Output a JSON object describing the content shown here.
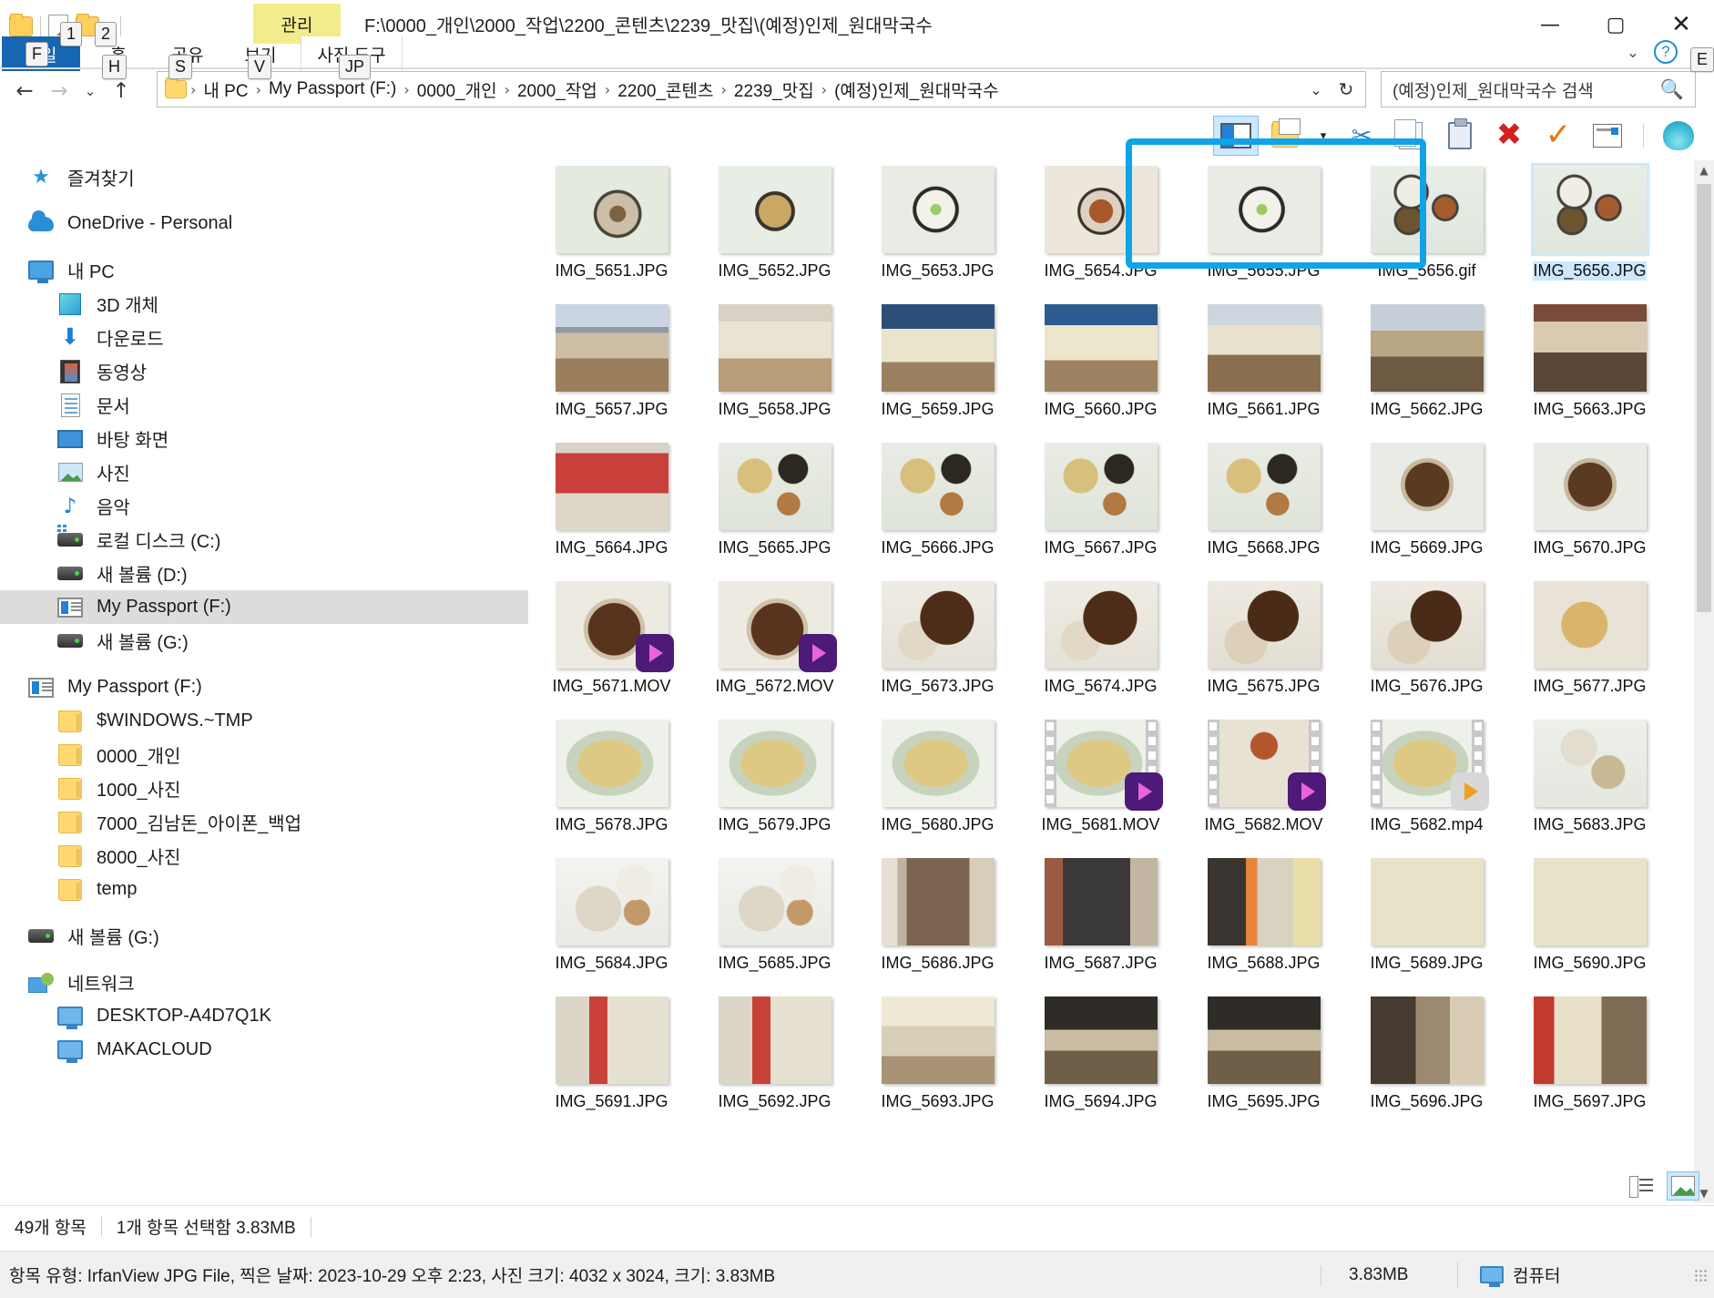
{
  "window": {
    "title": "F:\\0000_개인\\2000_작업\\2200_콘텐츠\\2239_맛집\\(예정)인제_원대막국수",
    "minimize": "—",
    "maximize": "▢",
    "close": "✕"
  },
  "quick_access": {
    "folder_icon": "folder-icon",
    "properties_icon": "properties-icon",
    "new_folder_icon": "new-folder-icon",
    "customize_arrow": "▾"
  },
  "ribbon": {
    "contextual_tab_group": "관리",
    "tabs": [
      {
        "id": "file",
        "label": "파일",
        "keytip": "F"
      },
      {
        "id": "home",
        "label": "홈",
        "keytip": "H"
      },
      {
        "id": "share",
        "label": "공유",
        "keytip": "S"
      },
      {
        "id": "view",
        "label": "보기",
        "keytip": "V"
      },
      {
        "id": "phototools",
        "label": "사진 도구",
        "keytip": "JP"
      }
    ],
    "qat_keytips": [
      "1",
      "2"
    ],
    "collapse_glyph": "⌄",
    "help_glyph": "?",
    "help_keytip": "E"
  },
  "address_bar": {
    "back_glyph": "←",
    "forward_glyph": "→",
    "recent_glyph": "⌄",
    "up_glyph": "↑",
    "breadcrumbs": [
      "내 PC",
      "My Passport (F:)",
      "0000_개인",
      "2000_작업",
      "2200_콘텐츠",
      "2239_맛집",
      "(예정)인제_원대막국수"
    ],
    "separator": "›",
    "dropdown_glyph": "⌄",
    "refresh_glyph": "↻"
  },
  "search": {
    "placeholder": "(예정)인제_원대막국수 검색",
    "icon": "search-icon"
  },
  "command_bar": {
    "items": [
      {
        "name": "navigation-pane-toggle",
        "label": "탐색 창",
        "active": true
      },
      {
        "name": "new-folder",
        "label": "새 폴더",
        "active": false
      },
      {
        "name": "new-folder-dropdown",
        "label": "▾",
        "active": false
      },
      {
        "name": "cut",
        "label": "잘라내기",
        "active": false
      },
      {
        "name": "copy",
        "label": "복사",
        "active": false
      },
      {
        "name": "paste",
        "label": "붙여넣기",
        "active": false
      },
      {
        "name": "delete",
        "label": "삭제",
        "active": false
      },
      {
        "name": "confirm",
        "label": "확인",
        "active": false
      },
      {
        "name": "rename",
        "label": "이름 바꾸기",
        "active": false
      },
      {
        "name": "shell-extension",
        "label": "셸 확장",
        "active": false
      }
    ]
  },
  "nav_pane": {
    "items": [
      {
        "label": "즐겨찾기",
        "icon": "star-icon",
        "indent": 0,
        "selected": false
      },
      {
        "label": "",
        "icon": "",
        "indent": 0,
        "selected": false,
        "gap": true
      },
      {
        "label": "OneDrive - Personal",
        "icon": "cloud-icon",
        "indent": 0,
        "selected": false
      },
      {
        "label": "",
        "icon": "",
        "indent": 0,
        "selected": false,
        "gap": true
      },
      {
        "label": "내 PC",
        "icon": "monitor-icon",
        "indent": 0,
        "selected": false
      },
      {
        "label": "3D 개체",
        "icon": "cube-icon",
        "indent": 1,
        "selected": false
      },
      {
        "label": "다운로드",
        "icon": "download-icon",
        "indent": 1,
        "selected": false
      },
      {
        "label": "동영상",
        "icon": "film-icon",
        "indent": 1,
        "selected": false
      },
      {
        "label": "문서",
        "icon": "document-icon",
        "indent": 1,
        "selected": false
      },
      {
        "label": "바탕 화면",
        "icon": "desktop-icon",
        "indent": 1,
        "selected": false
      },
      {
        "label": "사진",
        "icon": "picture-icon",
        "indent": 1,
        "selected": false
      },
      {
        "label": "음악",
        "icon": "music-note-icon",
        "indent": 1,
        "selected": false
      },
      {
        "label": "로컬 디스크 (C:)",
        "icon": "system-drive-icon",
        "indent": 1,
        "selected": false
      },
      {
        "label": "새 볼륨 (D:)",
        "icon": "drive-icon",
        "indent": 1,
        "selected": false
      },
      {
        "label": "My Passport (F:)",
        "icon": "passport-drive-icon",
        "indent": 1,
        "selected": true
      },
      {
        "label": "새 볼륨 (G:)",
        "icon": "drive-icon",
        "indent": 1,
        "selected": false
      },
      {
        "label": "",
        "icon": "",
        "indent": 0,
        "selected": false,
        "gap": true
      },
      {
        "label": "My Passport (F:)",
        "icon": "passport-drive-icon",
        "indent": 0,
        "selected": false
      },
      {
        "label": "$WINDOWS.~TMP",
        "icon": "folder-icon",
        "indent": 1,
        "selected": false
      },
      {
        "label": "0000_개인",
        "icon": "folder-icon",
        "indent": 1,
        "selected": false
      },
      {
        "label": "1000_사진",
        "icon": "folder-icon",
        "indent": 1,
        "selected": false
      },
      {
        "label": "7000_김남돈_아이폰_백업",
        "icon": "folder-icon",
        "indent": 1,
        "selected": false
      },
      {
        "label": "8000_사진",
        "icon": "folder-icon",
        "indent": 1,
        "selected": false
      },
      {
        "label": "temp",
        "icon": "folder-icon",
        "indent": 1,
        "selected": false
      },
      {
        "label": "",
        "icon": "",
        "indent": 0,
        "selected": false,
        "gap": true
      },
      {
        "label": "새 볼륨 (G:)",
        "icon": "drive-icon",
        "indent": 0,
        "selected": false
      },
      {
        "label": "",
        "icon": "",
        "indent": 0,
        "selected": false,
        "gap": true
      },
      {
        "label": "네트워크",
        "icon": "network-icon",
        "indent": 0,
        "selected": false
      },
      {
        "label": "DESKTOP-A4D7Q1K",
        "icon": "computer-icon",
        "indent": 1,
        "selected": false
      },
      {
        "label": "MAKACLOUD",
        "icon": "computer-icon",
        "indent": 1,
        "selected": false
      }
    ]
  },
  "files": [
    {
      "name": "IMG_5651.JPG",
      "kind": "image",
      "selected": false,
      "tint": "a"
    },
    {
      "name": "IMG_5652.JPG",
      "kind": "image",
      "selected": false,
      "tint": "b"
    },
    {
      "name": "IMG_5653.JPG",
      "kind": "image",
      "selected": false,
      "tint": "c"
    },
    {
      "name": "IMG_5654.JPG",
      "kind": "image",
      "selected": false,
      "tint": "d"
    },
    {
      "name": "IMG_5655.JPG",
      "kind": "image",
      "selected": false,
      "tint": "c"
    },
    {
      "name": "IMG_5656.gif",
      "kind": "image",
      "selected": false,
      "tint": "e"
    },
    {
      "name": "IMG_5656.JPG",
      "kind": "image",
      "selected": true,
      "tint": "e"
    },
    {
      "name": "IMG_5657.JPG",
      "kind": "image",
      "selected": false,
      "tint": "r1"
    },
    {
      "name": "IMG_5658.JPG",
      "kind": "image",
      "selected": false,
      "tint": "r2"
    },
    {
      "name": "IMG_5659.JPG",
      "kind": "image",
      "selected": false,
      "tint": "r3"
    },
    {
      "name": "IMG_5660.JPG",
      "kind": "image",
      "selected": false,
      "tint": "r4"
    },
    {
      "name": "IMG_5661.JPG",
      "kind": "image",
      "selected": false,
      "tint": "r5"
    },
    {
      "name": "IMG_5662.JPG",
      "kind": "image",
      "selected": false,
      "tint": "r6"
    },
    {
      "name": "IMG_5663.JPG",
      "kind": "image",
      "selected": false,
      "tint": "r7"
    },
    {
      "name": "IMG_5664.JPG",
      "kind": "image",
      "selected": false,
      "tint": "m1"
    },
    {
      "name": "IMG_5665.JPG",
      "kind": "image",
      "selected": false,
      "tint": "m2"
    },
    {
      "name": "IMG_5666.JPG",
      "kind": "image",
      "selected": false,
      "tint": "m2"
    },
    {
      "name": "IMG_5667.JPG",
      "kind": "image",
      "selected": false,
      "tint": "m2"
    },
    {
      "name": "IMG_5668.JPG",
      "kind": "image",
      "selected": false,
      "tint": "m2"
    },
    {
      "name": "IMG_5669.JPG",
      "kind": "image",
      "selected": false,
      "tint": "m3"
    },
    {
      "name": "IMG_5670.JPG",
      "kind": "image",
      "selected": false,
      "tint": "m3"
    },
    {
      "name": "IMG_5671.MOV",
      "kind": "video",
      "selected": false,
      "tint": "n1"
    },
    {
      "name": "IMG_5672.MOV",
      "kind": "video",
      "selected": false,
      "tint": "n1"
    },
    {
      "name": "IMG_5673.JPG",
      "kind": "image",
      "selected": false,
      "tint": "n2"
    },
    {
      "name": "IMG_5674.JPG",
      "kind": "image",
      "selected": false,
      "tint": "n2"
    },
    {
      "name": "IMG_5675.JPG",
      "kind": "image",
      "selected": false,
      "tint": "n3"
    },
    {
      "name": "IMG_5676.JPG",
      "kind": "image",
      "selected": false,
      "tint": "n3"
    },
    {
      "name": "IMG_5677.JPG",
      "kind": "image",
      "selected": false,
      "tint": "n4"
    },
    {
      "name": "IMG_5678.JPG",
      "kind": "image",
      "selected": false,
      "tint": "p1"
    },
    {
      "name": "IMG_5679.JPG",
      "kind": "image",
      "selected": false,
      "tint": "p1"
    },
    {
      "name": "IMG_5680.JPG",
      "kind": "image",
      "selected": false,
      "tint": "p1"
    },
    {
      "name": "IMG_5681.MOV",
      "kind": "video-film",
      "selected": false,
      "tint": "p1"
    },
    {
      "name": "IMG_5682.MOV",
      "kind": "video-film",
      "selected": false,
      "tint": "p2"
    },
    {
      "name": "IMG_5682.mp4",
      "kind": "video-film-orange",
      "selected": false,
      "tint": "p1"
    },
    {
      "name": "IMG_5683.JPG",
      "kind": "image",
      "selected": false,
      "tint": "p3"
    },
    {
      "name": "IMG_5684.JPG",
      "kind": "image",
      "selected": false,
      "tint": "q1"
    },
    {
      "name": "IMG_5685.JPG",
      "kind": "image",
      "selected": false,
      "tint": "q1"
    },
    {
      "name": "IMG_5686.JPG",
      "kind": "image",
      "selected": false,
      "tint": "q2"
    },
    {
      "name": "IMG_5687.JPG",
      "kind": "image",
      "selected": false,
      "tint": "q3"
    },
    {
      "name": "IMG_5688.JPG",
      "kind": "image",
      "selected": false,
      "tint": "q4"
    },
    {
      "name": "IMG_5689.JPG",
      "kind": "image",
      "selected": false,
      "tint": "q5"
    },
    {
      "name": "IMG_5690.JPG",
      "kind": "image",
      "selected": false,
      "tint": "q5"
    },
    {
      "name": "IMG_5691.JPG",
      "kind": "image",
      "selected": false,
      "tint": "s1"
    },
    {
      "name": "IMG_5692.JPG",
      "kind": "image",
      "selected": false,
      "tint": "s1"
    },
    {
      "name": "IMG_5693.JPG",
      "kind": "image",
      "selected": false,
      "tint": "s2"
    },
    {
      "name": "IMG_5694.JPG",
      "kind": "image",
      "selected": false,
      "tint": "s3"
    },
    {
      "name": "IMG_5695.JPG",
      "kind": "image",
      "selected": false,
      "tint": "s3"
    },
    {
      "name": "IMG_5696.JPG",
      "kind": "image",
      "selected": false,
      "tint": "s4"
    },
    {
      "name": "IMG_5697.JPG",
      "kind": "image",
      "selected": false,
      "tint": "s5"
    }
  ],
  "annotation": {
    "highlight_color": "#10a3e8",
    "target_label": "IMG_5656 pair highlight"
  },
  "status_bar": {
    "item_count": "49개 항목",
    "selection": "1개 항목 선택함 3.83MB",
    "details": "항목 유형: IrfanView JPG File, 찍은 날짜: 2023-10-29 오후 2:23, 사진 크기: 4032 x 3024, 크기: 3.83MB",
    "size": "3.83MB",
    "location": "컴퓨터",
    "location_icon": "computer-icon"
  },
  "view_toggles": [
    {
      "name": "details-view",
      "label": "자세히",
      "active": false
    },
    {
      "name": "large-icons-view",
      "label": "큰 아이콘",
      "active": true
    }
  ],
  "scrollbar": {
    "up": "▲",
    "down": "▼"
  },
  "colors": {
    "accent_selection": "#cce8ff",
    "annotation_blue": "#10a3e8",
    "ribbon_file_tab": "#1667b1",
    "contextual_tab": "#f2ec8b"
  }
}
